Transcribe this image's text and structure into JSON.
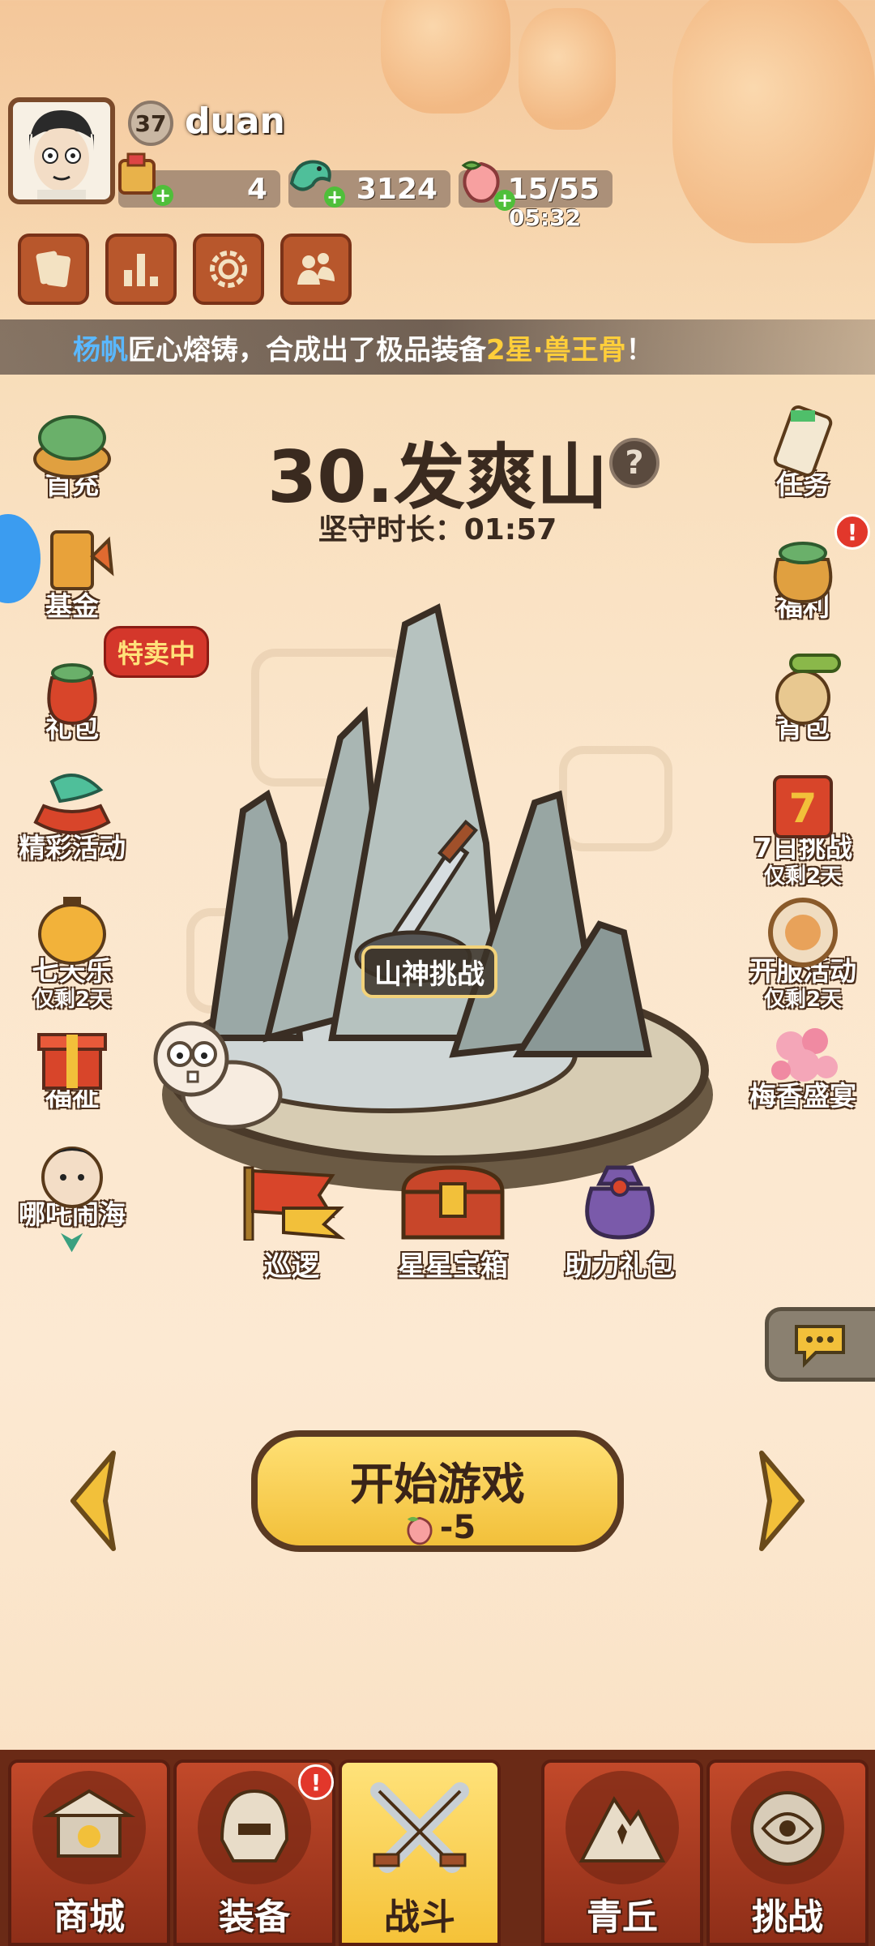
{
  "player": {
    "level": "37",
    "name": "duan"
  },
  "resources": {
    "scrolls": "4",
    "jade": "3124",
    "stamina": "15/55",
    "stamina_timer": "05:32"
  },
  "announcement": {
    "player": "杨帆",
    "text1": " 匠心熔铸，合成出了极品装备 ",
    "item": "2星·兽王骨",
    "text2": "！"
  },
  "stage": {
    "title": "30.发爽山",
    "guard_label": "坚守时长：",
    "guard_time": "01:57",
    "boss_label": "山神挑战"
  },
  "left_menu": {
    "first_charge": "首充",
    "fund": "基金",
    "gift_pack": "礼包",
    "sale_tag": "特卖中",
    "events": "精彩活动",
    "seven_days": "七天乐",
    "seven_days_sub": "仅剩2天",
    "welfare": "福祉",
    "nezha": "哪吒闹海"
  },
  "right_menu": {
    "tasks": "任务",
    "benefits": "福利",
    "bag": "背包",
    "challenge7": "7日挑战",
    "challenge7_sub": "仅剩2天",
    "server_event": "开服活动",
    "server_event_sub": "仅剩2天",
    "plum_feast": "梅香盛宴"
  },
  "stage_actions": {
    "patrol": "巡逻",
    "star_chest": "星星宝箱",
    "assist_pack": "助力礼包"
  },
  "start_button": {
    "label": "开始游戏",
    "cost": "-5"
  },
  "bottom_nav": {
    "shop": "商城",
    "equipment": "装备",
    "battle": "战斗",
    "qingqiu": "青丘",
    "challenge": "挑战"
  },
  "colors": {
    "accent_gold": "#f5c238",
    "nav_red": "#c2492a",
    "badge_red": "#e2372b"
  }
}
